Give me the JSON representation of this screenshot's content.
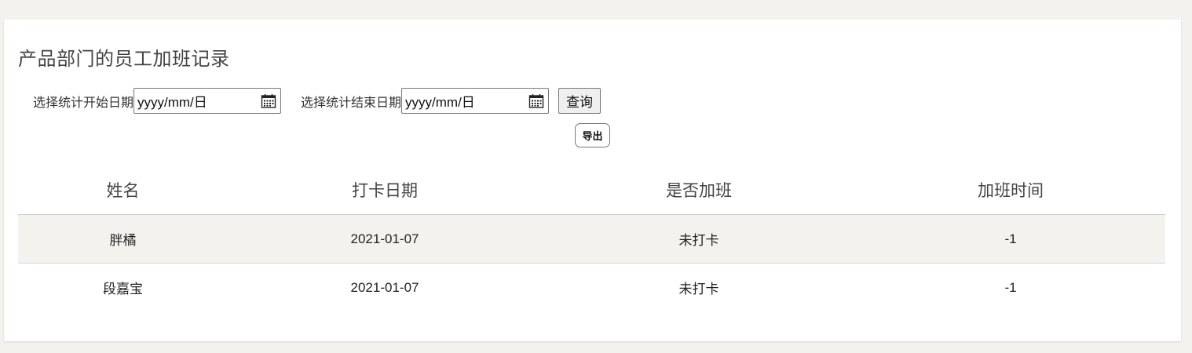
{
  "page": {
    "title": "产品部门的员工加班记录"
  },
  "filters": {
    "start_label": "选择统计开始日期",
    "start_value": "yyyy/mm/日",
    "end_label": "选择统计结束日期",
    "end_value": "yyyy/mm/日",
    "query_label": "查询",
    "export_label": "导出"
  },
  "table": {
    "columns": [
      "姓名",
      "打卡日期",
      "是否加班",
      "加班时间"
    ],
    "rows": [
      [
        "胖橘",
        "2021-01-07",
        "未打卡",
        "-1"
      ],
      [
        "段嘉宝",
        "2021-01-07",
        "未打卡",
        "-1"
      ]
    ]
  },
  "icons": {
    "date_picker": "calendar-icon"
  },
  "colors": {
    "background": "#f3f2ef",
    "card": "#ffffff",
    "shaded_row": "#f3f2ef"
  }
}
